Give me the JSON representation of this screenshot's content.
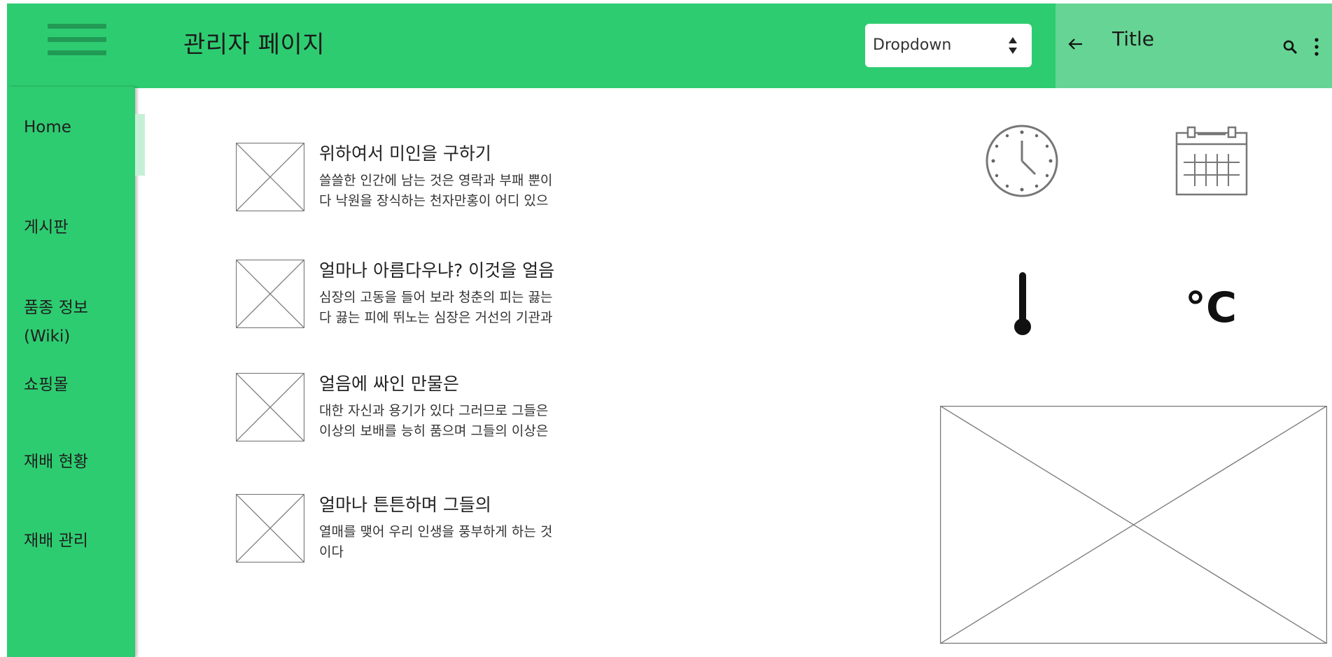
{
  "header": {
    "title": "관리자 페이지",
    "dropdown_value": "Dropdown",
    "menu_icon": "hamburger-menu-icon",
    "bg_color": "#2ecc71"
  },
  "appbar": {
    "title": "Title",
    "back_icon": "back-arrow-icon",
    "search_icon": "search-icon",
    "more_icon": "more-vert-icon",
    "bg_color": "#66d494"
  },
  "sidebar": {
    "items": [
      {
        "label": "Home"
      },
      {
        "label": "게시판"
      },
      {
        "label": "품종 정보\n(Wiki)"
      },
      {
        "label": "쇼핑몰"
      },
      {
        "label": "재배 현황"
      },
      {
        "label": "재배 관리"
      }
    ],
    "selected_index": 0
  },
  "content": {
    "items": [
      {
        "title": "위하여서 미인을 구하기",
        "desc": "쓸쓸한 인간에 남는 것은 영락과 부패 뿐이\n다 낙원을 장식하는 천자만홍이 어디 있으"
      },
      {
        "title": "얼마나 아름다우냐? 이것을 얼음",
        "desc": "심장의 고동을 들어 보라 청춘의 피는 끓는\n다 끓는 피에 뛰노는 심장은 거선의 기관과"
      },
      {
        "title": "얼음에 싸인 만물은",
        "desc": "대한 자신과 용기가 있다 그러므로 그들은\n이상의 보배를 능히 품으며 그들의 이상은"
      },
      {
        "title": "얼마나 튼튼하며 그들의",
        "desc": "열매를 맺어 우리 인생을 풍부하게 하는 것\n이다"
      }
    ]
  },
  "widgets": {
    "icons": [
      "clock-icon",
      "calendar-icon",
      "thermometer-icon"
    ],
    "temperature_unit": "°C"
  }
}
